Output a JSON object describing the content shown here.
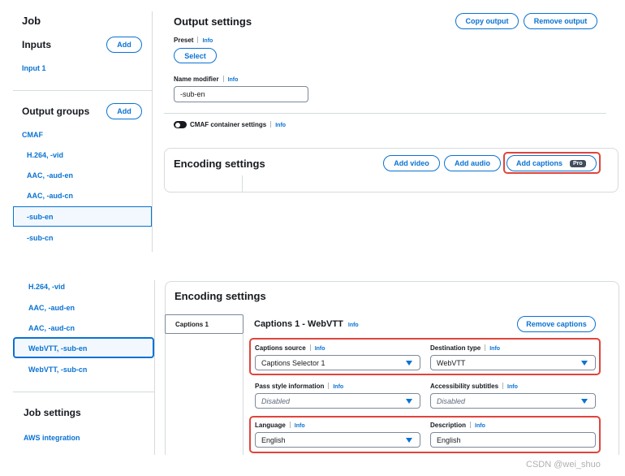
{
  "top": {
    "sidebar": {
      "job_title": "Job",
      "inputs_title": "Inputs",
      "inputs_add": "Add",
      "input_1": "Input 1",
      "output_groups_title": "Output groups",
      "output_groups_add": "Add",
      "group_cmaf": "CMAF",
      "items": [
        "H.264, -vid",
        "AAC, -aud-en",
        "AAC, -aud-cn",
        "-sub-en",
        "-sub-cn"
      ]
    },
    "output_settings": {
      "title": "Output settings",
      "copy_output": "Copy output",
      "remove_output": "Remove output",
      "preset_label": "Preset",
      "preset_info": "Info",
      "select_button": "Select",
      "name_modifier_label": "Name modifier",
      "name_modifier_info": "Info",
      "name_modifier_value": "-sub-en",
      "cmaf_toggle_label": "CMAF container settings",
      "cmaf_info": "Info"
    },
    "encoding": {
      "title": "Encoding settings",
      "add_video": "Add video",
      "add_audio": "Add audio",
      "add_captions": "Add captions",
      "pro_badge": "Pro"
    }
  },
  "bottom": {
    "sidebar": {
      "items": [
        "H.264, -vid",
        "AAC, -aud-en",
        "AAC, -aud-cn",
        "WebVTT, -sub-en",
        "WebVTT, -sub-cn"
      ],
      "selected_index": 3,
      "job_settings_title": "Job settings",
      "aws_integration": "AWS integration"
    },
    "encoding": {
      "title": "Encoding settings",
      "tab_captions_1": "Captions 1",
      "captions_title": "Captions 1 - WebVTT",
      "captions_info": "Info",
      "remove_captions": "Remove captions",
      "captions_source_label": "Captions source",
      "captions_source_info": "Info",
      "captions_source_value": "Captions Selector 1",
      "destination_type_label": "Destination type",
      "destination_type_info": "Info",
      "destination_type_value": "WebVTT",
      "pass_style_label": "Pass style information",
      "pass_style_info": "Info",
      "pass_style_value": "Disabled",
      "accessibility_label": "Accessibility subtitles",
      "accessibility_info": "Info",
      "accessibility_value": "Disabled",
      "language_label": "Language",
      "language_info": "Info",
      "language_value": "English",
      "description_label": "Description",
      "description_info": "Info",
      "description_value": "English"
    }
  },
  "watermark": "CSDN @wei_shuo",
  "colors": {
    "accent": "#0972d3",
    "highlight": "#e0443c",
    "text": "#16191f",
    "border": "#d5dbdb"
  }
}
